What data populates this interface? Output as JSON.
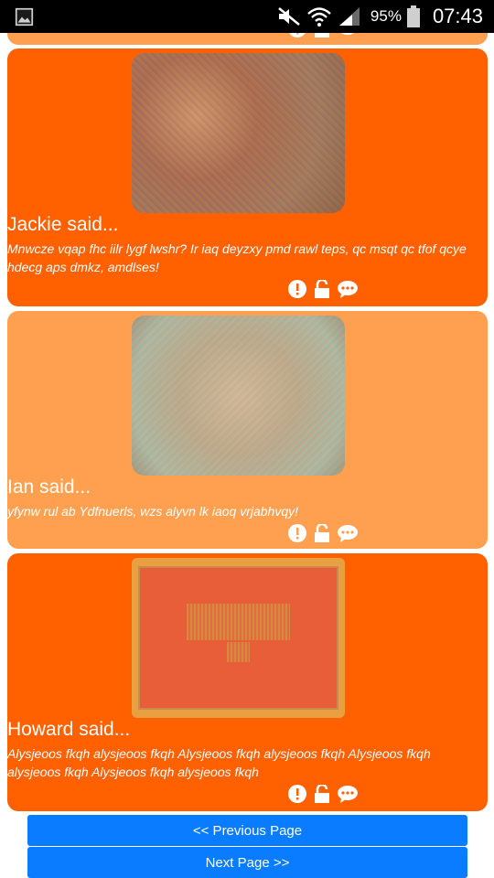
{
  "status_bar": {
    "battery_percent": "95%",
    "time": "07:43"
  },
  "posts": [
    {
      "author_label": "Jackie said...",
      "message": "Mnwcze vqap fhc iilr lygf lwshr? Ir iaq deyzxy pmd rawl teps, qc msqt qc tfof qcye hdecg aps dmkz, amdlses!"
    },
    {
      "author_label": "Ian said...",
      "message": "yfynw rul ab Ydfnuerls, wzs alyvn lk iaoq vrjabhvqy!"
    },
    {
      "author_label": "Howard said...",
      "message": "Alysjeoos fkqh alysjeoos fkqh Alysjeoos fkqh alysjeoos fkqh Alysjeoos fkqh alysjeoos fkqh Alysjeoos fkqh alysjeoos fkqh"
    }
  ],
  "pagination": {
    "previous_label": "<< Previous Page",
    "next_label": "Next Page >>"
  },
  "colors": {
    "card_dark": "#ff6000",
    "card_light": "#ffa050",
    "button": "#0a7cff"
  },
  "icons": [
    "alert-icon",
    "unlock-icon",
    "comment-icon"
  ]
}
